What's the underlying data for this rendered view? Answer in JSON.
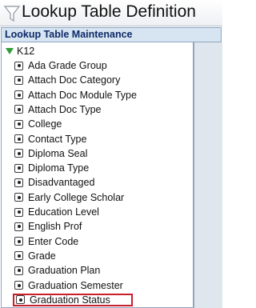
{
  "title": "Lookup Table Definition",
  "panel_header": "Lookup Table Maintenance",
  "tree": {
    "root_label": "K12",
    "items": [
      {
        "label": "Ada Grade Group"
      },
      {
        "label": "Attach Doc Category"
      },
      {
        "label": "Attach Doc Module Type"
      },
      {
        "label": "Attach Doc Type"
      },
      {
        "label": "College"
      },
      {
        "label": "Contact Type"
      },
      {
        "label": "Diploma Seal"
      },
      {
        "label": "Diploma Type"
      },
      {
        "label": "Disadvantaged"
      },
      {
        "label": "Early College Scholar"
      },
      {
        "label": "Education Level"
      },
      {
        "label": "English Prof"
      },
      {
        "label": "Enter Code"
      },
      {
        "label": "Grade"
      },
      {
        "label": "Graduation Plan"
      },
      {
        "label": "Graduation Semester"
      },
      {
        "label": "Graduation Status"
      }
    ],
    "selected_item": "Graduation Status"
  },
  "icons": {
    "title_icon": "funnel-icon",
    "expand_icon": "expanded-triangle-icon",
    "item_icon": "table-node-icon"
  },
  "colors": {
    "header_bg": "#d7e4f2",
    "header_text": "#0d2a66",
    "tree_border": "#8fa6c0",
    "expand_triangle": "#2f9e3a",
    "selection_outline": "#c8202a"
  }
}
